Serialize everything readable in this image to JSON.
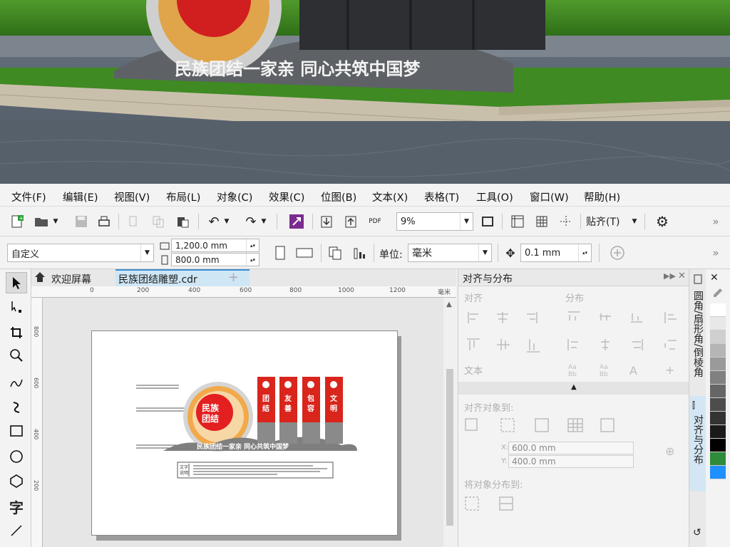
{
  "photo": {
    "slogan": "民族团结一家亲 同心共筑中国梦"
  },
  "menu": [
    "文件(F)",
    "编辑(E)",
    "视图(V)",
    "布局(L)",
    "对象(C)",
    "效果(C)",
    "位图(B)",
    "文本(X)",
    "表格(T)",
    "工具(O)",
    "窗口(W)",
    "帮助(H)"
  ],
  "toolbar1": {
    "zoom_value": "9%",
    "snap_label": "贴齐(T)",
    "pdf_label": "PDF"
  },
  "toolbar2": {
    "page_preset": "自定义",
    "width_value": "1,200.0 mm",
    "height_value": "800.0 mm",
    "units_label": "单位:",
    "units_value": "毫米",
    "nudge_value": "0.1 mm"
  },
  "tabs": {
    "welcome": "欢迎屏幕",
    "document": "民族团结雕塑.cdr",
    "add": "+"
  },
  "ruler": {
    "ticks": [
      "0",
      "200",
      "400",
      "600",
      "800",
      "1000",
      "1200"
    ],
    "unit": "毫米",
    "vticks": [
      "800",
      "600",
      "400",
      "200"
    ]
  },
  "artwork": {
    "emblem_text": "民族\n团结",
    "pillars": [
      "团结",
      "友善",
      "包容",
      "文明"
    ],
    "slogan": "民族团结一家亲 同心共筑中国梦",
    "plaque_label": "文字说明"
  },
  "panel": {
    "title": "对齐与分布",
    "align_label": "对齐",
    "distribute_label": "分布",
    "text_label": "文本",
    "align_to_label": "对齐对象到:",
    "x_label": "X:",
    "x_value": "600.0 mm",
    "y_label": "Y:",
    "y_value": "400.0 mm",
    "distribute_to_label": "将对象分布到:"
  },
  "side_tabs": {
    "fillet": "圆角/扇形角/倒棱角",
    "align": "对齐与分布"
  },
  "palette_colors": [
    "#ffffff",
    "#e8e8e8",
    "#cfcfcf",
    "#b5b5b5",
    "#9a9a9a",
    "#808080",
    "#666666",
    "#4d4d4d",
    "#333333",
    "#1a1a1a",
    "#000000",
    "#2e8b3a",
    "#1e90ff"
  ]
}
